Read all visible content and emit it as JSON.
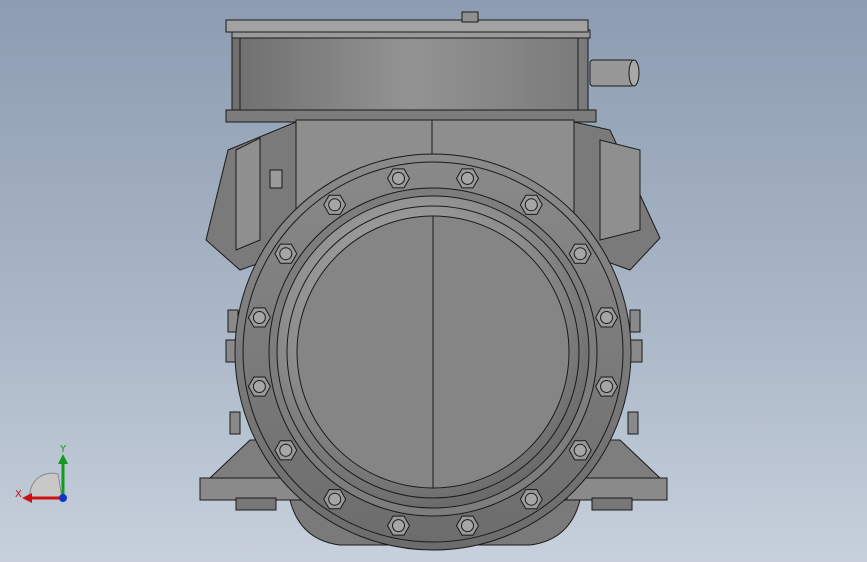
{
  "viewport": {
    "background_top": "#8d9cb1",
    "background_bottom": "#c7d0dc",
    "part_color": "#8a8a8a",
    "edge_color": "#1a1a1a"
  },
  "triad": {
    "x_label": "X",
    "y_label": "Y",
    "x_color": "#cc1111",
    "y_color": "#119922",
    "z_color": "#1133cc"
  }
}
